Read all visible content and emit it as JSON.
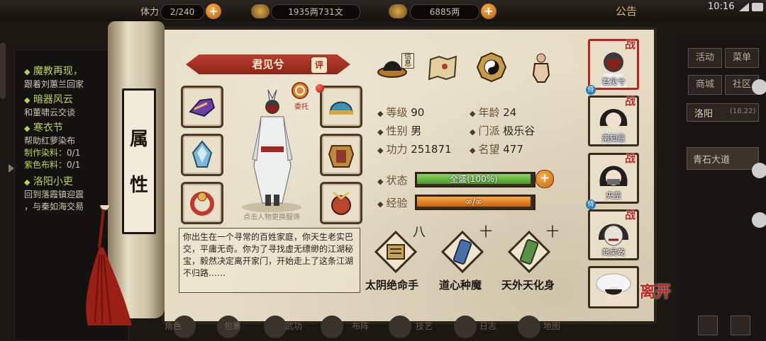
{
  "topbar": {
    "stamina": "2/240",
    "silver": "1935两731文",
    "gold": "6885两",
    "notice": "公告",
    "clock": "10:16",
    "left_label_partial": "体力"
  },
  "quests": {
    "items": [
      {
        "title": "魔教再现，",
        "desc": "跟着刘蕙兰回家"
      },
      {
        "title": "暗器风云",
        "desc": "和董啸云交谈"
      },
      {
        "title": "寒衣节",
        "desc": "帮助红萝染布",
        "materials": [
          {
            "k": "制作染料",
            "v": "：0/1"
          },
          {
            "k": "紫色布料",
            "v": "：0/1"
          }
        ]
      },
      {
        "title": "洛阳小吏",
        "desc": "回到落霞镇迎震",
        "desc2": "，与秦如海交易"
      }
    ]
  },
  "hud": {
    "activity": "活动",
    "menu": "菜单",
    "shop": "商城",
    "community": "社区",
    "location": "洛阳",
    "coords": "(18,22)",
    "sub_location": "青石大道"
  },
  "panel": {
    "vertical_title": [
      "属",
      "性"
    ],
    "character_name": "君见兮",
    "eval_badge": "评",
    "entrust_label": "委托",
    "costume_hint": "点击人物更换服饰",
    "info_label": "信息",
    "bio": "你出生在一个寻常的百姓家庭，你天生老实巴交，平庸无奇。你为了寻找虚无缥缈的江湖秘宝，毅然决定离开家门，开始走上了这条江湖不归路……",
    "stats": {
      "level_label": "等级",
      "level": "90",
      "age_label": "年龄",
      "age": "24",
      "gender_label": "性别",
      "gender": "男",
      "sect_label": "门派",
      "sect": "极乐谷",
      "power_label": "功力",
      "power": "251871",
      "fame_label": "名望",
      "fame": "477"
    },
    "state_label": "状态",
    "state_value": "全盛(100%)",
    "state_fraction": 1.0,
    "exp_label": "经验",
    "exp_value": "∞/∞",
    "plus": "+",
    "skills": [
      {
        "name": "太阴绝命手",
        "level": "八"
      },
      {
        "name": "道心种魔",
        "level": "十"
      },
      {
        "name": "天外天化身",
        "level": "十"
      }
    ],
    "leave": "离开"
  },
  "roster": [
    {
      "name": "君见兮",
      "badge": "战",
      "selected": true,
      "tag": "侍"
    },
    {
      "name": "南知意",
      "badge": "战",
      "selected": false,
      "tag": ""
    },
    {
      "name": "央蛮",
      "badge": "战",
      "selected": false,
      "tag": "侍"
    },
    {
      "name": "商昊乾",
      "badge": "战",
      "selected": false,
      "tag": ""
    },
    {
      "name": "",
      "badge": "",
      "selected": false,
      "tag": ""
    }
  ],
  "bottom_nav": [
    "角色",
    "包裹",
    "武功",
    "布阵",
    "技艺",
    "日志",
    "地图"
  ],
  "colors": {
    "accent_red": "#b6251a",
    "state_green": "#4b9a2a",
    "exp_orange": "#c8640f",
    "quest_green": "#b9d455"
  }
}
